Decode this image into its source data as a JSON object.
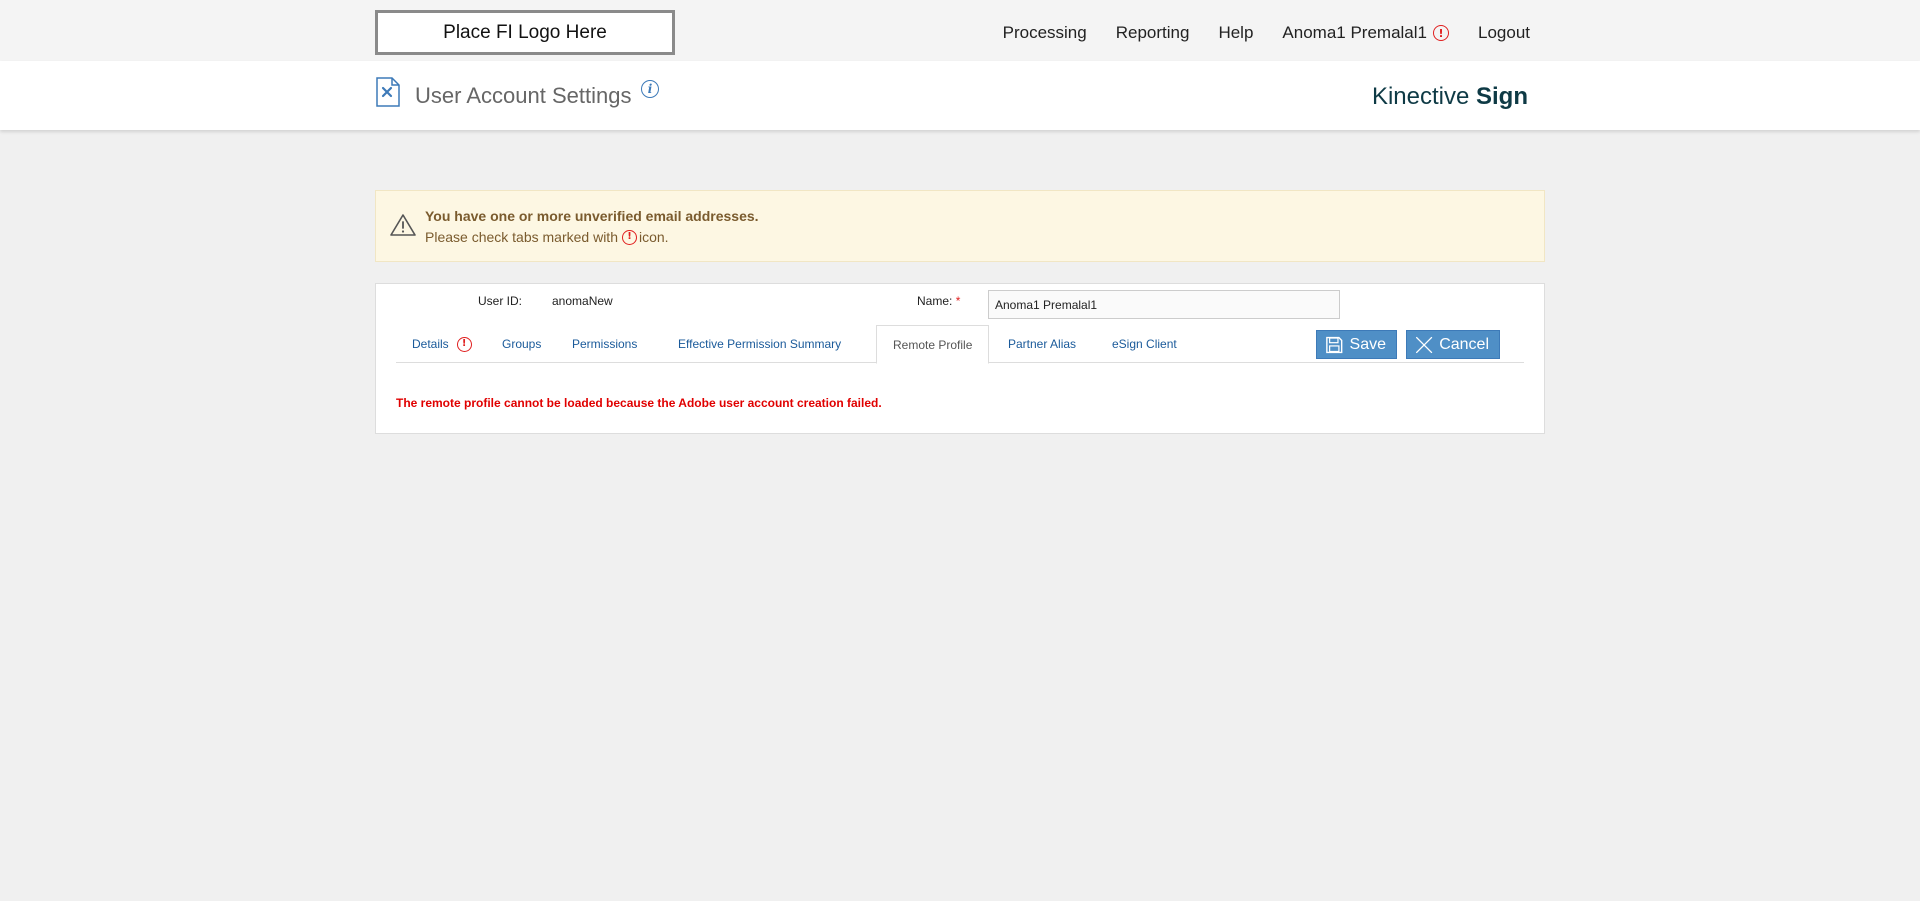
{
  "topbar": {
    "logo_text": "Place FI Logo Here",
    "nav": [
      {
        "label": "Processing"
      },
      {
        "label": "Reporting"
      },
      {
        "label": "Help"
      },
      {
        "label": "Anoma1 Premalal1",
        "alert": true
      },
      {
        "label": "Logout"
      }
    ]
  },
  "header": {
    "title": "User Account Settings",
    "info_icon": "info-icon",
    "brand_light": "Kinective ",
    "brand_bold": "Sign"
  },
  "warning": {
    "title": "You have one or more unverified email addresses.",
    "text_before": "Please check tabs marked with",
    "text_after": "icon."
  },
  "form": {
    "user_id_label": "User ID:",
    "user_id_value": "anomaNew",
    "name_label": "Name:",
    "name_required": "*",
    "name_value": "Anoma1 Premalal1"
  },
  "tabs": [
    {
      "label": "Details",
      "alert": true
    },
    {
      "label": "Groups"
    },
    {
      "label": "Permissions"
    },
    {
      "label": "Effective Permission Summary"
    },
    {
      "label": "Remote Profile",
      "active": true
    },
    {
      "label": "Partner Alias"
    },
    {
      "label": "eSign Client"
    }
  ],
  "buttons": {
    "save_label": "Save",
    "cancel_label": "Cancel"
  },
  "error_message": "The remote profile cannot be loaded because the Adobe user account creation failed.",
  "colors": {
    "accent": "#4f8fc6",
    "error": "#e00000",
    "warning_bg": "#fdf7e3",
    "link": "#1a5a9a"
  }
}
